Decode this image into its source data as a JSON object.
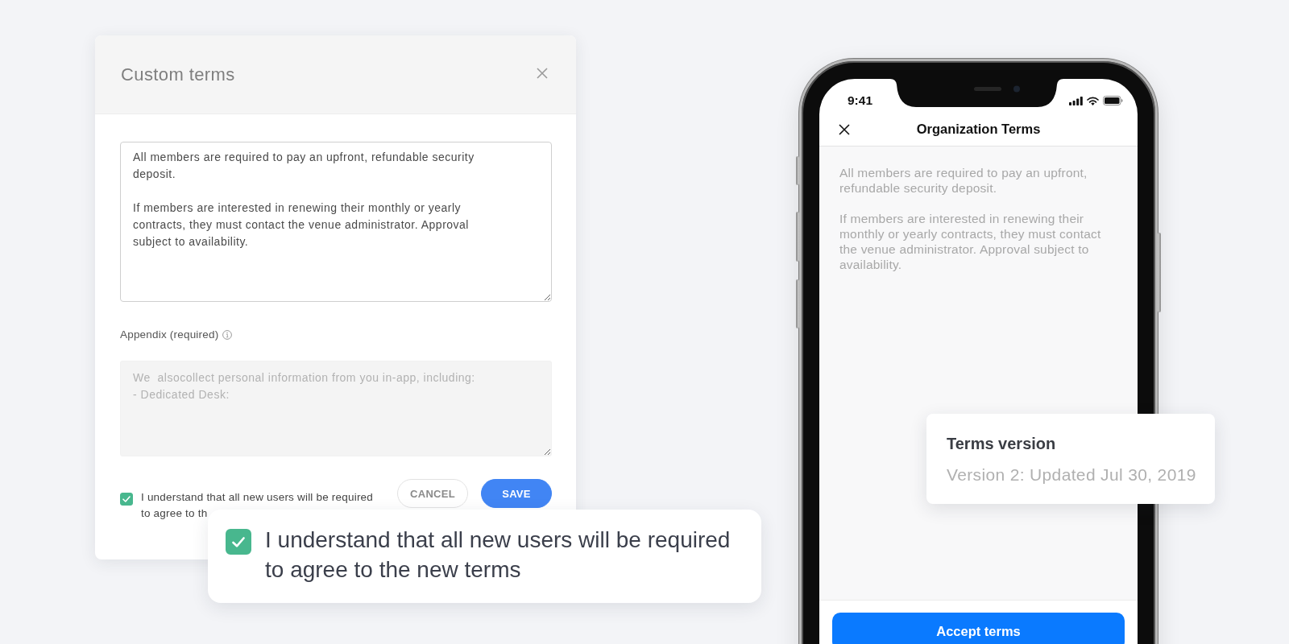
{
  "modal": {
    "title": "Custom terms",
    "terms_field": {
      "value": "All members are required to pay an upfront, refundable security\ndeposit.\n\nIf members are interested in renewing their monthly or yearly\ncontracts, they must contact the venue administrator. Approval\nsubject to availability."
    },
    "appendix_label": "Appendix (required)",
    "appendix_field": {
      "placeholder": "We  alsocollect personal information from you in-app, including:\n- Dedicated Desk:"
    },
    "agreement": {
      "checked": true,
      "label": "I understand that all new users will be required to agree to th"
    },
    "buttons": [
      {
        "label": "CANCEL",
        "kind": "secondary"
      },
      {
        "label": "SAVE",
        "kind": "primary"
      }
    ]
  },
  "callout": {
    "checked": true,
    "label": "I understand that all new users will be required to agree to the new terms"
  },
  "phone": {
    "status_bar": {
      "time": "9:41"
    },
    "nav": {
      "title": "Organization Terms"
    },
    "paragraphs": [
      "All members are required to pay an upfront, refundable security deposit.",
      "If members are interested in renewing their monthly or yearly contracts, they must contact the venue administrator. Approval subject to availability."
    ],
    "button": "Accept terms"
  },
  "version_card": {
    "title": "Terms version",
    "text": "Version 2: Updated Jul 30, 2019"
  }
}
